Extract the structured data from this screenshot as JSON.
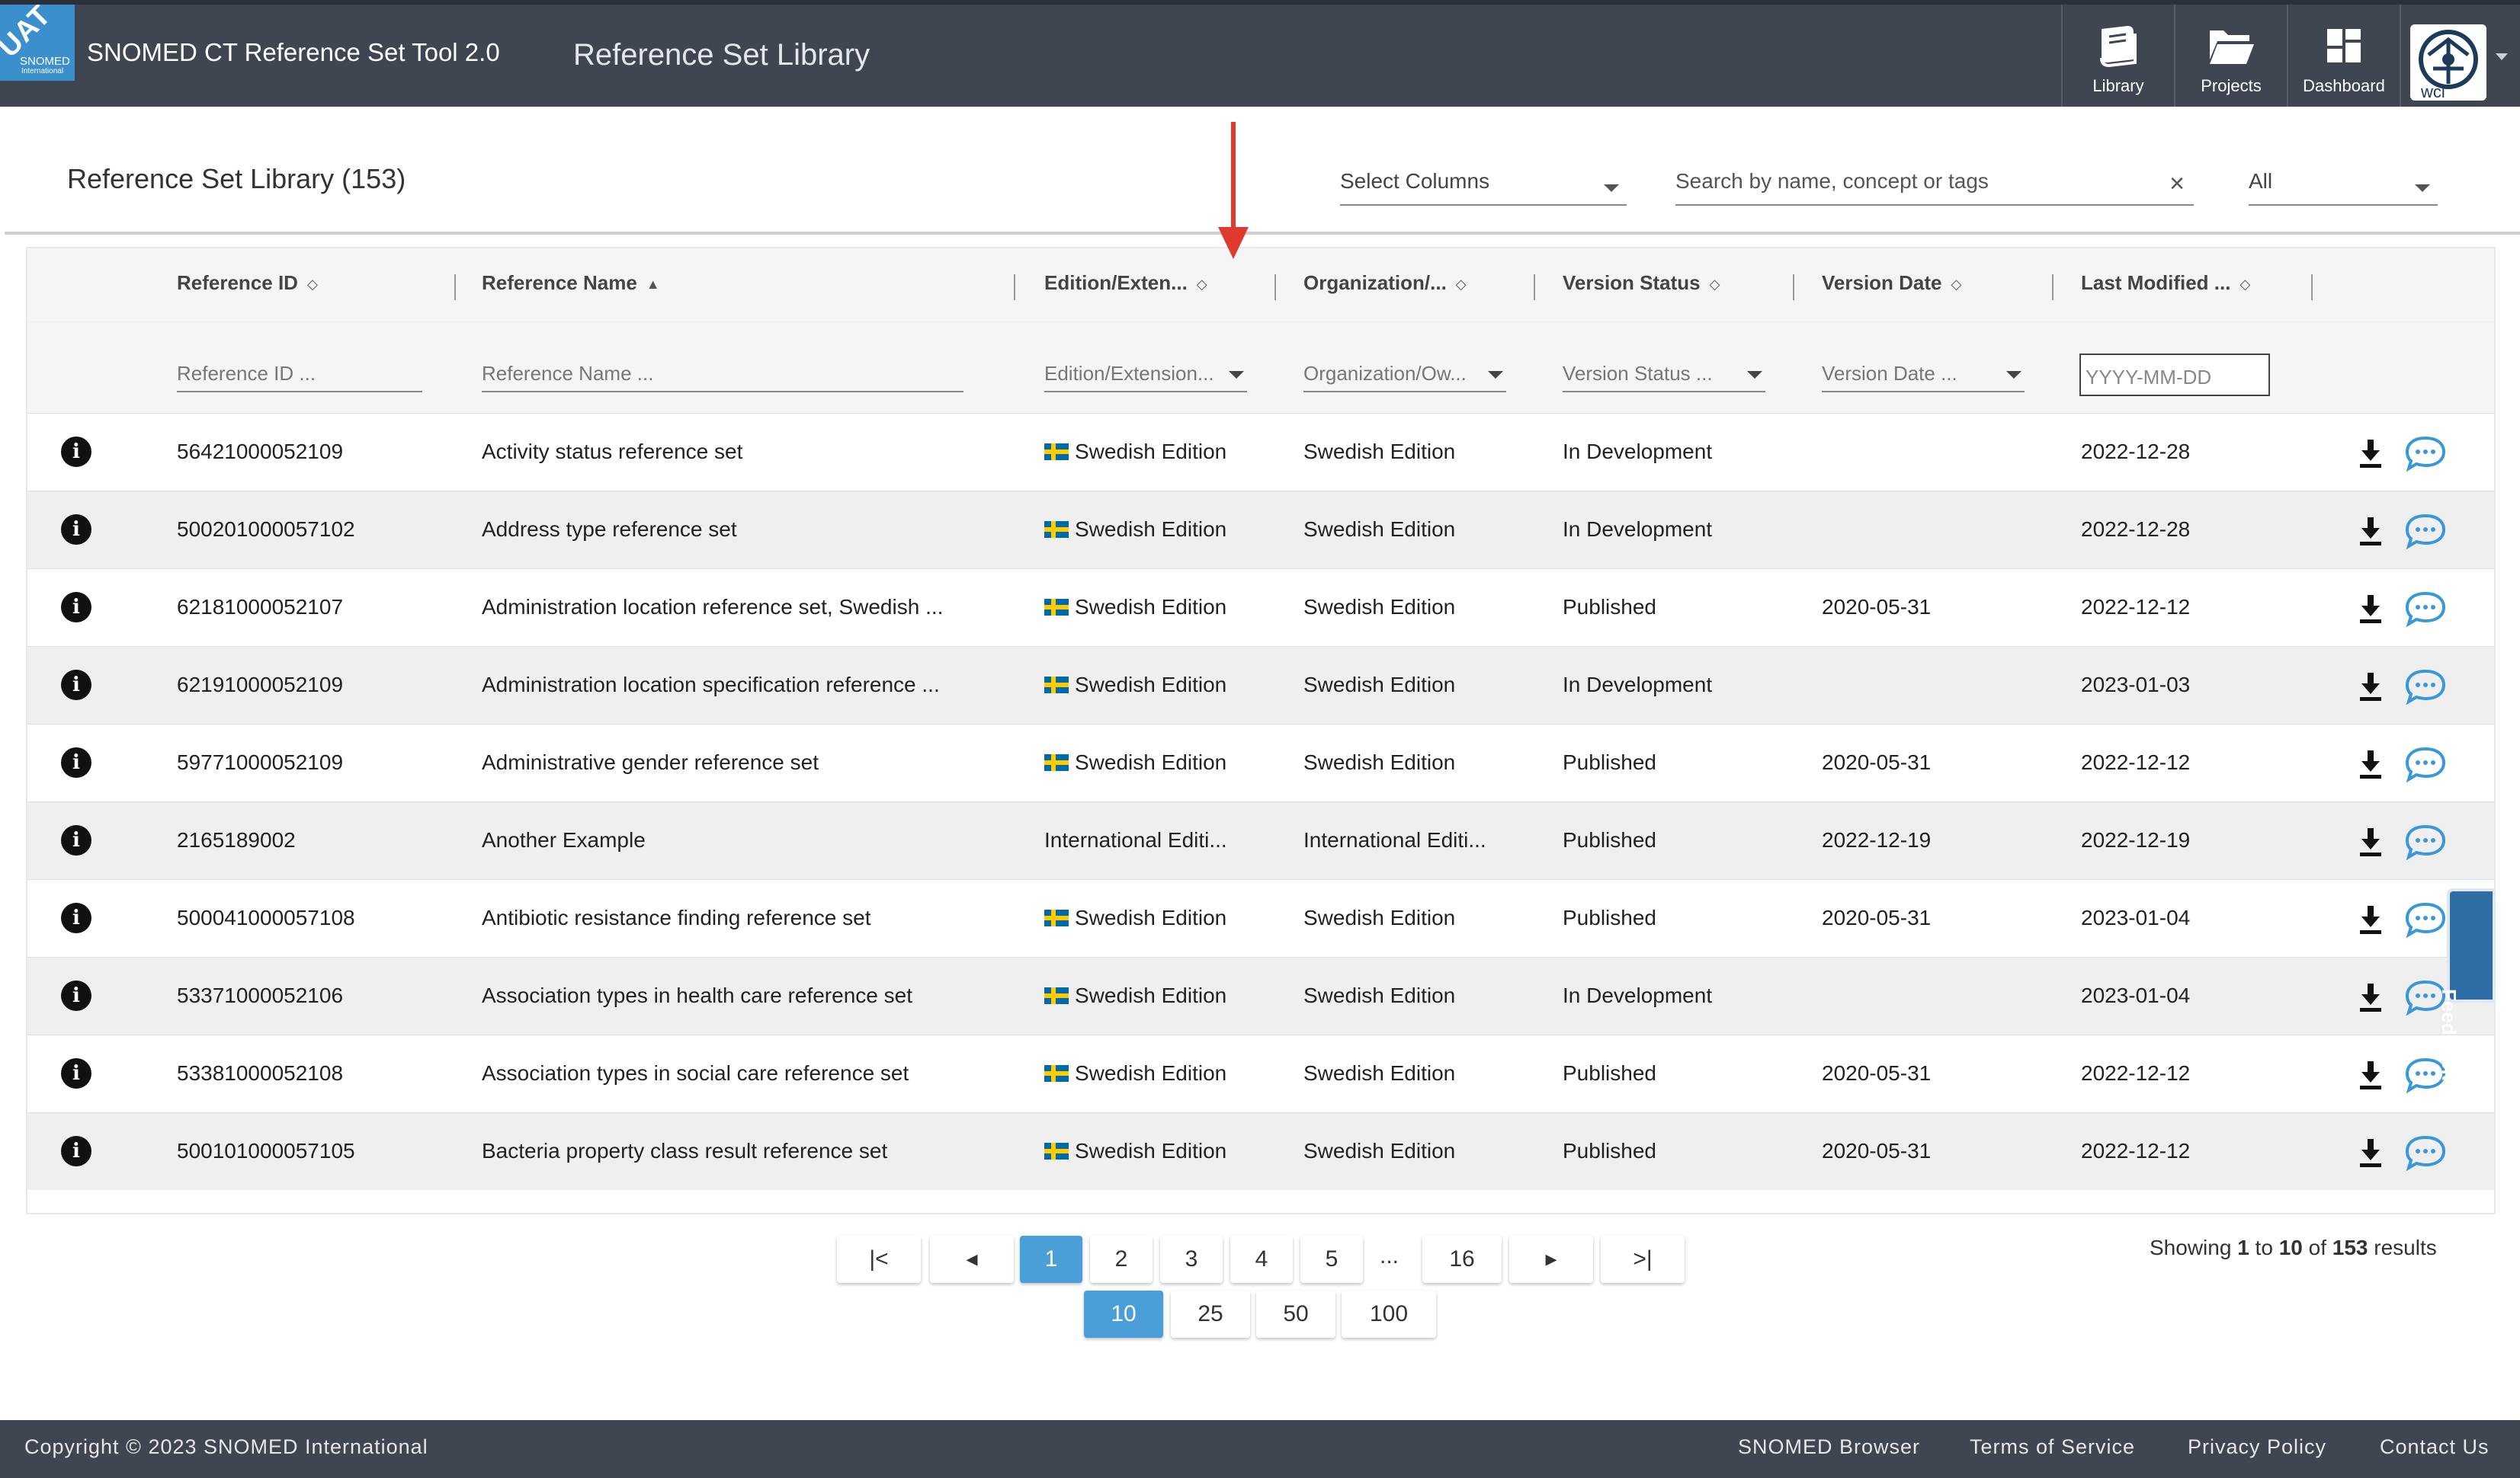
{
  "header": {
    "badge": "UAT",
    "badge_brand": "SNOMED",
    "badge_sub": "International",
    "app_title": "SNOMED CT Reference Set Tool 2.0",
    "page_heading": "Reference Set Library",
    "nav": [
      {
        "label": "Library",
        "icon": "book-icon"
      },
      {
        "label": "Projects",
        "icon": "folder-icon"
      },
      {
        "label": "Dashboard",
        "icon": "dashboard-icon"
      }
    ],
    "avatar_text": "wci"
  },
  "library": {
    "title": "Reference Set Library (153)",
    "select_columns": "Select Columns",
    "search_placeholder": "Search by name, concept or tags",
    "scope_select": "All"
  },
  "table": {
    "columns": [
      "Reference ID",
      "Reference Name",
      "Edition/Exten...",
      "Organization/...",
      "Version Status",
      "Version Date",
      "Last Modified ..."
    ],
    "filters": [
      "Reference ID ...",
      "Reference Name ...",
      "Edition/Extension...",
      "Organization/Ow...",
      "Version Status ...",
      "Version Date ...",
      "YYYY-MM-DD"
    ],
    "rows": [
      {
        "id": "56421000052109",
        "name": "Activity status reference set",
        "edition": "Swedish Edition",
        "flag": true,
        "org": "Swedish Edition",
        "status": "In Development",
        "vdate": "",
        "modified": "2022-12-28"
      },
      {
        "id": "500201000057102",
        "name": "Address type reference set",
        "edition": "Swedish Edition",
        "flag": true,
        "org": "Swedish Edition",
        "status": "In Development",
        "vdate": "",
        "modified": "2022-12-28"
      },
      {
        "id": "62181000052107",
        "name": "Administration location reference set, Swedish ...",
        "edition": "Swedish Edition",
        "flag": true,
        "org": "Swedish Edition",
        "status": "Published",
        "vdate": "2020-05-31",
        "modified": "2022-12-12"
      },
      {
        "id": "62191000052109",
        "name": "Administration location specification reference ...",
        "edition": "Swedish Edition",
        "flag": true,
        "org": "Swedish Edition",
        "status": "In Development",
        "vdate": "",
        "modified": "2023-01-03"
      },
      {
        "id": "59771000052109",
        "name": "Administrative gender reference set",
        "edition": "Swedish Edition",
        "flag": true,
        "org": "Swedish Edition",
        "status": "Published",
        "vdate": "2020-05-31",
        "modified": "2022-12-12"
      },
      {
        "id": "2165189002",
        "name": "Another Example",
        "edition": "International Editi...",
        "flag": false,
        "org": "International Editi...",
        "status": "Published",
        "vdate": "2022-12-19",
        "modified": "2022-12-19"
      },
      {
        "id": "500041000057108",
        "name": "Antibiotic resistance finding reference set",
        "edition": "Swedish Edition",
        "flag": true,
        "org": "Swedish Edition",
        "status": "Published",
        "vdate": "2020-05-31",
        "modified": "2023-01-04"
      },
      {
        "id": "53371000052106",
        "name": "Association types in health care reference set",
        "edition": "Swedish Edition",
        "flag": true,
        "org": "Swedish Edition",
        "status": "In Development",
        "vdate": "",
        "modified": "2023-01-04"
      },
      {
        "id": "53381000052108",
        "name": "Association types in social care reference set",
        "edition": "Swedish Edition",
        "flag": true,
        "org": "Swedish Edition",
        "status": "Published",
        "vdate": "2020-05-31",
        "modified": "2022-12-12"
      },
      {
        "id": "500101000057105",
        "name": "Bacteria property class result reference set",
        "edition": "Swedish Edition",
        "flag": true,
        "org": "Swedish Edition",
        "status": "Published",
        "vdate": "2020-05-31",
        "modified": "2022-12-12"
      }
    ]
  },
  "feedback_label": "Feedback",
  "pagination": {
    "first": "|<",
    "prev": "◂",
    "pages": [
      "1",
      "2",
      "3",
      "4",
      "5"
    ],
    "ellipsis": "...",
    "last_page": "16",
    "next": "▸",
    "last": ">|",
    "current": "1",
    "page_sizes": [
      "10",
      "25",
      "50",
      "100"
    ],
    "current_size": "10",
    "showing_prefix": "Showing",
    "showing_from": "1",
    "showing_to_word": "to",
    "showing_to": "10",
    "showing_of_word": "of",
    "showing_total": "153",
    "showing_suffix": "results"
  },
  "footer": {
    "copyright": "Copyright © 2023 SNOMED International",
    "links": [
      "SNOMED Browser",
      "Terms of Service",
      "Privacy Policy",
      "Contact Us"
    ]
  },
  "colors": {
    "header_bg": "#3e4652",
    "accent": "#4a9fd8",
    "badge_bg": "#3a8fcc",
    "annotation_arrow": "#e03a2f"
  }
}
